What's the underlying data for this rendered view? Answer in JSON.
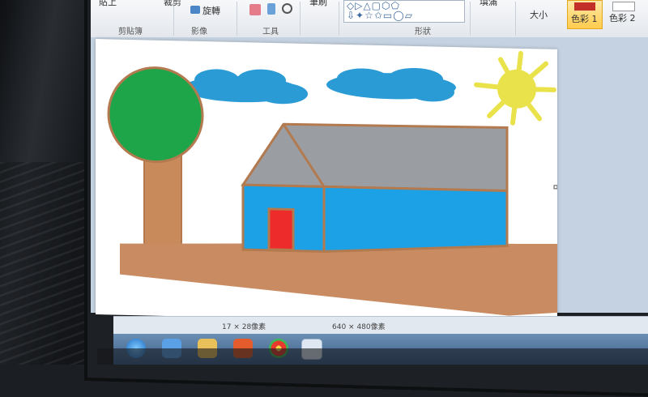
{
  "window": {
    "app": "Paint",
    "language": "zh-Hant"
  },
  "ribbon": {
    "paste_label": "貼上",
    "crop_label": "裁剪",
    "rotate_label": "旋轉",
    "brushes_label": "筆刷",
    "size_label": "大小",
    "fill_label": "填滿",
    "color1_label": "色彩 1",
    "color2_label": "色彩 2",
    "groups": {
      "clipboard": "剪貼簿",
      "image": "影像",
      "tools": "工具",
      "shapes": "形狀"
    },
    "shapes_rows": [
      "◇▷△▢⬡⬠",
      "⇩✦☆✩▭◯▱",
      "➤✚⬟◎☁◌"
    ]
  },
  "canvas": {
    "scene": {
      "sky": "#ffffff",
      "tree_crown": "#1ea54a",
      "tree_trunk": "#c88a5a",
      "cloud": "#2b9bd6",
      "sun": "#e9e24a",
      "roof": "#9a9ea3",
      "wall": "#1ca0e6",
      "door": "#ee2b2b",
      "outline": "#b27a4e",
      "ground": "#c98c62"
    }
  },
  "status": {
    "cursor_pos": "17 × 28像素",
    "canvas_size": "640 × 480像素"
  },
  "colors": {
    "ribbon_bg": "#eef1f5",
    "workspace_bg": "#c5d2e1",
    "accent": "#ffcc4d"
  }
}
